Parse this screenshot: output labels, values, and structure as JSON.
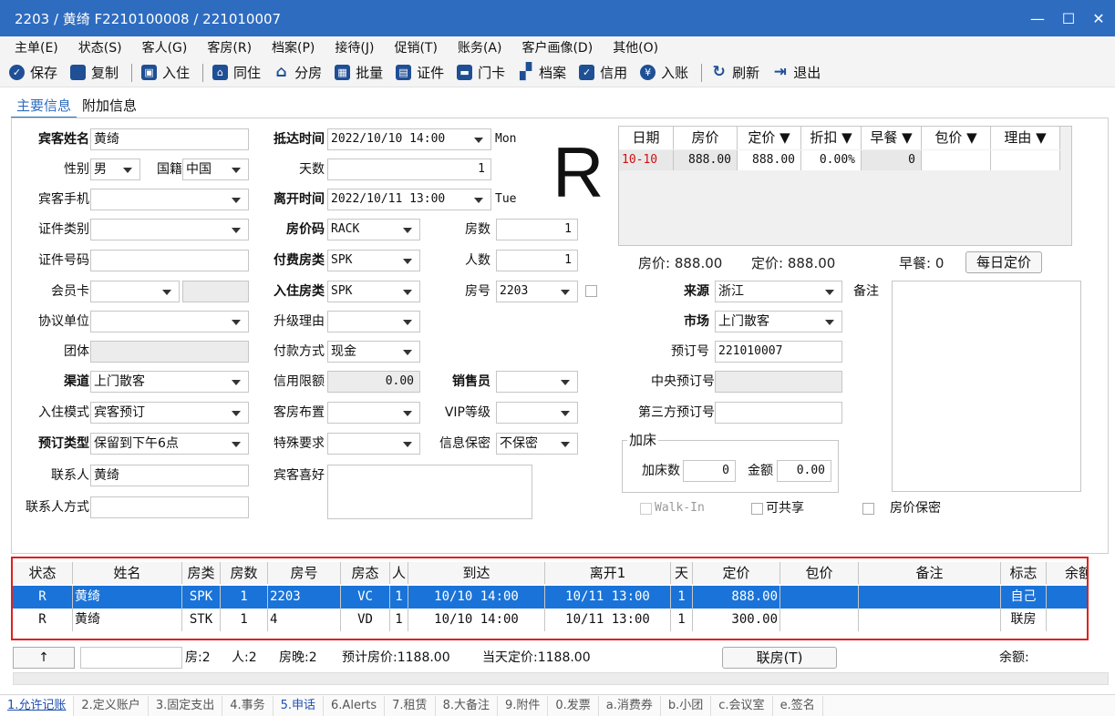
{
  "window": {
    "title": "2203 / 黄绮 F2210100008 / 221010007",
    "min": "—",
    "max": "☐",
    "close": "✕"
  },
  "menu": [
    "主单(E)",
    "状态(S)",
    "客人(G)",
    "客房(R)",
    "档案(P)",
    "接待(J)",
    "促销(T)",
    "账务(A)",
    "客户画像(D)",
    "其他(O)"
  ],
  "toolbar": {
    "save": "保存",
    "copy": "复制",
    "checkin": "入住",
    "share": "同住",
    "split": "分房",
    "batch": "批量",
    "cert": "证件",
    "card": "门卡",
    "profile": "档案",
    "credit": "信用",
    "post": "入账",
    "refresh": "刷新",
    "exit": "退出"
  },
  "tabs": [
    "主要信息",
    "附加信息"
  ],
  "form": {
    "guest_name_label": "宾客姓名",
    "guest_name": "黄绮",
    "gender_label": "性别",
    "gender": "男",
    "nationality_label": "国籍",
    "nationality": "中国",
    "mobile_label": "宾客手机",
    "cert_type_label": "证件类别",
    "cert_no_label": "证件号码",
    "member_label": "会员卡",
    "agreement_label": "协议单位",
    "group_label": "团体",
    "channel_label": "渠道",
    "channel": "上门散客",
    "checkin_mode_label": "入住模式",
    "checkin_mode": "宾客预订",
    "reserve_type_label": "预订类型",
    "reserve_type": "保留到下午6点",
    "contact_label": "联系人",
    "contact": "黄绮",
    "contact_way_label": "联系人方式",
    "arrival_label": "抵达时间",
    "arrival": "2022/10/10 14:00",
    "arrival_day": "Mon",
    "days_label": "天数",
    "days": "1",
    "departure_label": "离开时间",
    "departure": "2022/10/11 13:00",
    "departure_day": "Tue",
    "ratecode_label": "房价码",
    "ratecode": "RACK",
    "rooms_label": "房数",
    "rooms": "1",
    "paytype_label": "付费房类",
    "paytype": "SPK",
    "persons_label": "人数",
    "persons": "1",
    "roomtype_label": "入住房类",
    "roomtype": "SPK",
    "roomno_label": "房号",
    "roomno": "2203",
    "upgrade_label": "升级理由",
    "payment_label": "付款方式",
    "payment": "现金",
    "creditlimit_label": "信用限额",
    "creditlimit": "0.00",
    "sales_label": "销售员",
    "layout_label": "客房布置",
    "vip_label": "VIP等级",
    "special_label": "特殊要求",
    "privacy_label": "信息保密",
    "privacy": "不保密",
    "preference_label": "宾客喜好",
    "status_big": "R",
    "source_label": "来源",
    "source": "浙江",
    "remark_label": "备注",
    "market_label": "市场",
    "market": "上门散客",
    "booking_no_label": "预订号",
    "booking_no": "221010007",
    "central_no_label": "中央预订号",
    "third_no_label": "第三方预订号",
    "extrabed_label": "加床",
    "extrabed_count_label": "加床数",
    "extrabed_count": "0",
    "extrabed_amount_label": "金额",
    "extrabed_amount": "0.00",
    "walkin": "Walk-In",
    "shareable": "可共享",
    "rate_secret": "房价保密"
  },
  "rate_grid": {
    "headers": [
      "日期",
      "房价",
      "定价 ▼",
      "折扣 ▼",
      "早餐 ▼",
      "包价 ▼",
      "理由 ▼"
    ],
    "row": [
      "10-10",
      "888.00",
      "888.00",
      "0.00%",
      "0",
      "",
      ""
    ],
    "summary_rate": "房价: 888.00",
    "summary_list": "定价: 888.00",
    "summary_bf": "早餐: 0",
    "daily_btn": "每日定价"
  },
  "list": {
    "headers": [
      "状态",
      "姓名",
      "房类",
      "房数",
      "房号",
      "房态",
      "人",
      "到达",
      "离开1",
      "天",
      "定价",
      "包价",
      "备注",
      "标志",
      "余额"
    ],
    "rows": [
      [
        "R",
        "黄绮",
        "SPK",
        "1",
        "2203",
        "VC",
        "1",
        "10/10 14:00",
        "10/11 13:00",
        "1",
        "888.00",
        "",
        "",
        "自己",
        ""
      ],
      [
        "R",
        "黄绮",
        "STK",
        "1",
        "4",
        "VD",
        "1",
        "10/10 14:00",
        "10/11 13:00",
        "1",
        "300.00",
        "",
        "",
        "联房",
        ""
      ]
    ]
  },
  "status": {
    "up_btn": "↑",
    "rooms": "房:2",
    "persons": "人:2",
    "nights": "房晚:2",
    "est": "预计房价:1188.00",
    "today": "当天定价:1188.00",
    "link_btn": "联房(T)",
    "balance": "余额:"
  },
  "bottom_tabs": [
    "1.允许记账",
    "2.定义账户",
    "3.固定支出",
    "4.事务",
    "5.申话",
    "6.Alerts",
    "7.租赁",
    "8.大备注",
    "9.附件",
    "0.发票",
    "a.消费券",
    "b.小团",
    "c.会议室",
    "e.签名"
  ]
}
